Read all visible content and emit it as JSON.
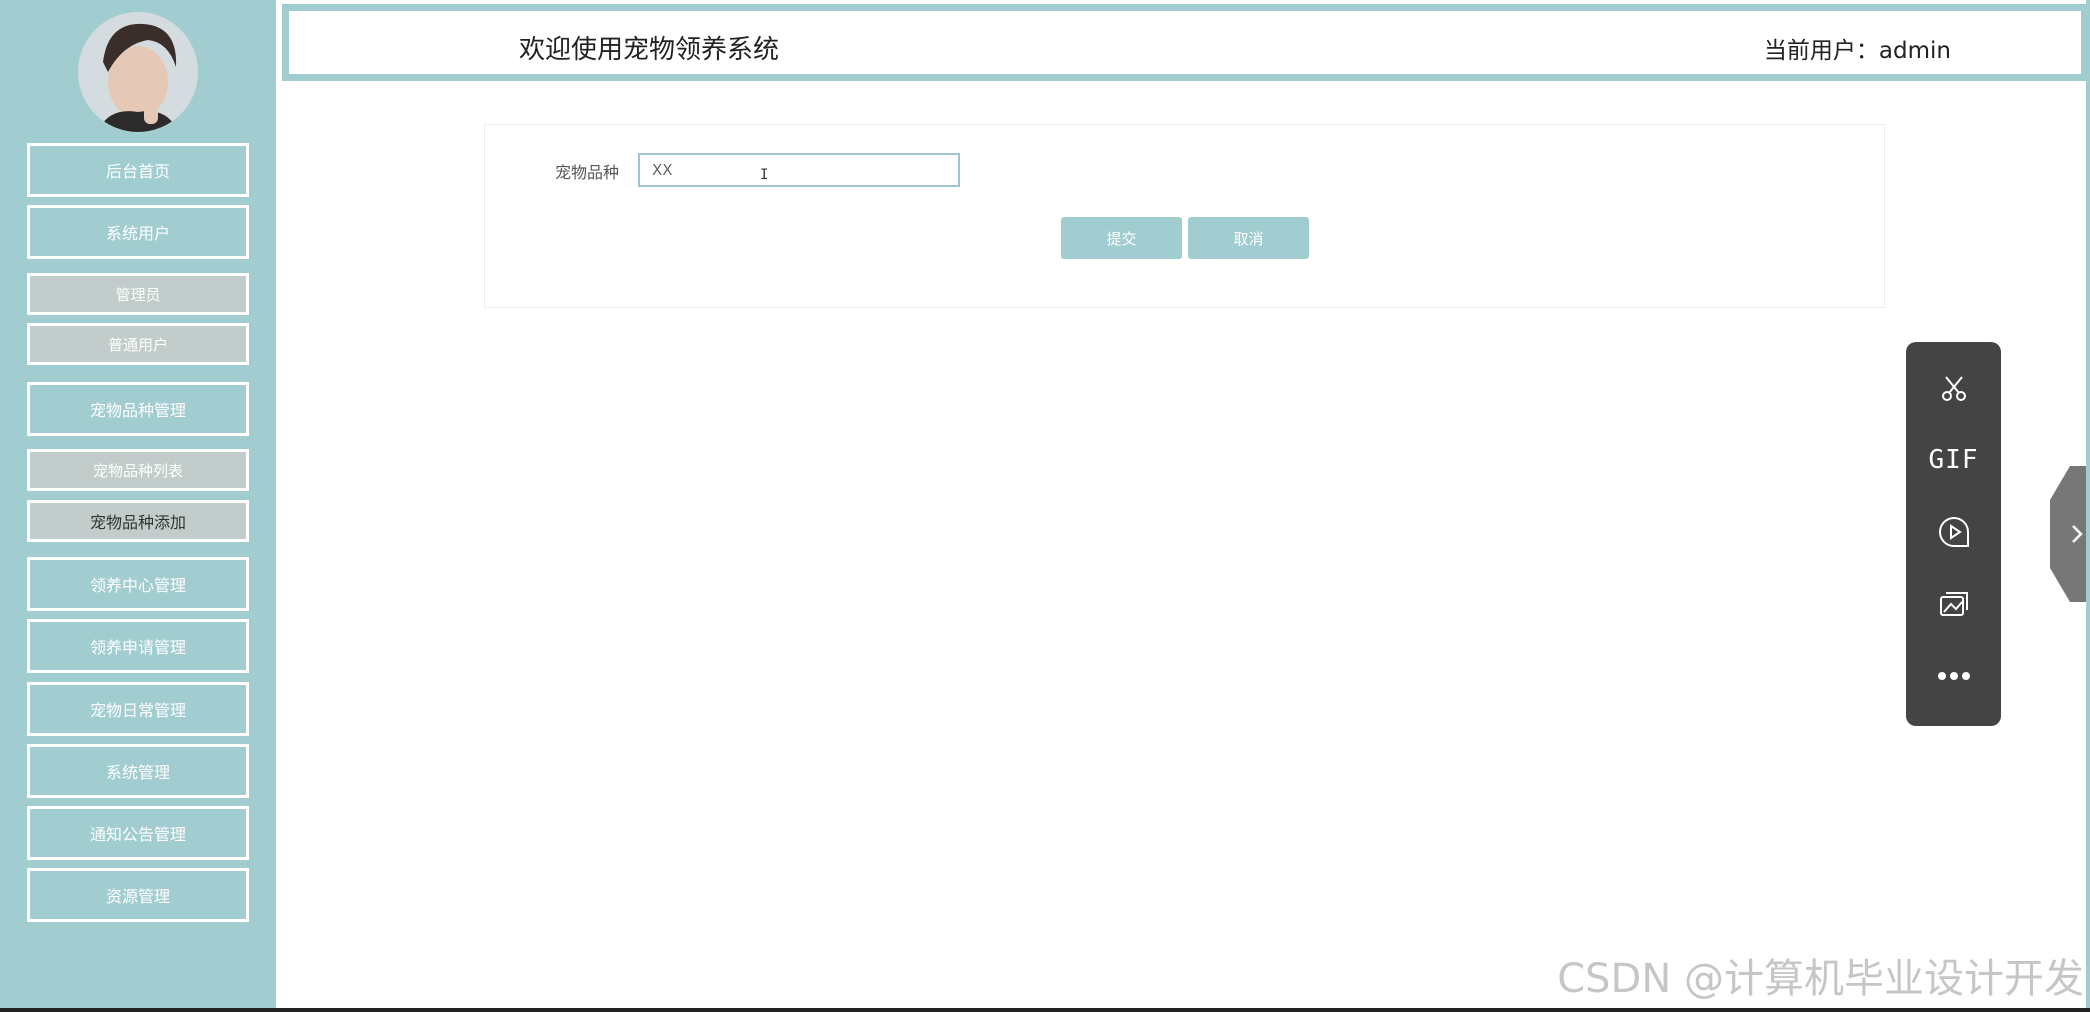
{
  "header": {
    "title": "欢迎使用宠物领养系统",
    "current_user": "当前用户：admin"
  },
  "sidebar": {
    "items": [
      {
        "label": "后台首页"
      },
      {
        "label": "系统用户"
      },
      {
        "label": "管理员"
      },
      {
        "label": "普通用户"
      },
      {
        "label": "宠物品种管理"
      },
      {
        "label": "宠物品种列表"
      },
      {
        "label": "宠物品种添加"
      },
      {
        "label": "领养中心管理"
      },
      {
        "label": "领养申请管理"
      },
      {
        "label": "宠物日常管理"
      },
      {
        "label": "系统管理"
      },
      {
        "label": "通知公告管理"
      },
      {
        "label": "资源管理"
      }
    ]
  },
  "form": {
    "field_label": "宠物品种",
    "field_value": "XX",
    "submit_label": "提交",
    "cancel_label": "取消"
  },
  "toolbar": {
    "gif_label": "GIF",
    "icons": [
      "scissors-icon",
      "gif-icon",
      "record-icon",
      "image-icon",
      "more-icon"
    ]
  },
  "watermark": "CSDN @计算机毕业设计开发",
  "colors": {
    "accent": "#a1cdd1",
    "sub_item": "#c2cccb",
    "toolbar": "#444444"
  }
}
